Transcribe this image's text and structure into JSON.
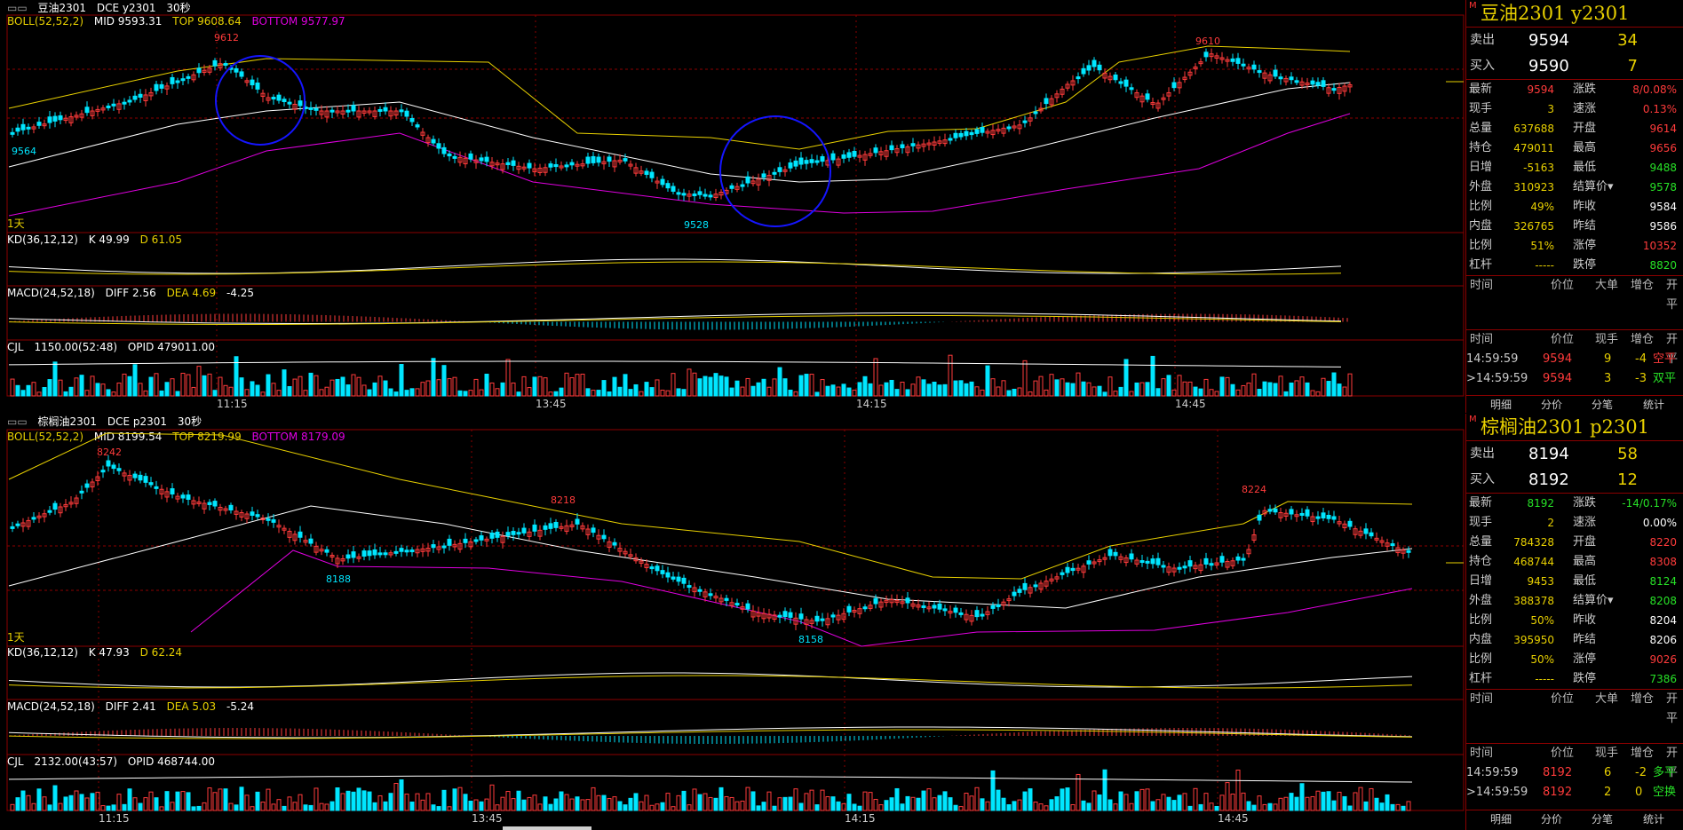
{
  "top": {
    "window_title": "豆油2301",
    "market": "DCE y2301",
    "interval": "30秒",
    "boll_label": "BOLL(52,52,2)",
    "boll_mid": "MID 9593.31",
    "boll_top": "TOP 9608.64",
    "boll_bottom": "BOTTOM 9577.97",
    "period_tag": "1天",
    "high_mark": "9612",
    "high_mark2": "9610",
    "low_mark": "9528",
    "left_mark": "9564",
    "kd_label": "KD(36,12,12)",
    "kd_k": "K 49.99",
    "kd_d": "D 61.05",
    "macd_label": "MACD(24,52,18)",
    "macd_diff": "DIFF 2.56",
    "macd_dea": "DEA 4.69",
    "macd_val": "-4.25",
    "cjl_label": "CJL",
    "cjl_val": "1150.00(52:48)",
    "cjl_opid": "OPID 479011.00",
    "times": [
      "11:15",
      "13:45",
      "14:15",
      "14:45"
    ],
    "side": {
      "title": "豆油2301  y2301",
      "sell_label": "卖出",
      "sell_price": "9594",
      "sell_vol": "34",
      "buy_label": "买入",
      "buy_price": "9590",
      "buy_vol": "7",
      "rows": [
        {
          "l1": "最新",
          "v1": "9594",
          "c1": "red",
          "l2": "涨跌",
          "v2": "8/0.08%",
          "c2": "red"
        },
        {
          "l1": "现手",
          "v1": "3",
          "c1": "yellow",
          "l2": "速涨",
          "v2": "0.13%",
          "c2": "red"
        },
        {
          "l1": "总量",
          "v1": "637688",
          "c1": "yellow",
          "l2": "开盘",
          "v2": "9614",
          "c2": "red"
        },
        {
          "l1": "持仓",
          "v1": "479011",
          "c1": "yellow",
          "l2": "最高",
          "v2": "9656",
          "c2": "red"
        },
        {
          "l1": "日增",
          "v1": "-5163",
          "c1": "yellow",
          "l2": "最低",
          "v2": "9488",
          "c2": "green"
        },
        {
          "l1": "外盘",
          "v1": "310923",
          "c1": "yellow",
          "l2": "结算价▾",
          "v2": "9578",
          "c2": "green"
        },
        {
          "l1": "比例",
          "v1": "49%",
          "c1": "yellow",
          "l2": "昨收",
          "v2": "9584",
          "c2": "white"
        },
        {
          "l1": "内盘",
          "v1": "326765",
          "c1": "yellow",
          "l2": "昨结",
          "v2": "9586",
          "c2": "white"
        },
        {
          "l1": "比例",
          "v1": "51%",
          "c1": "yellow",
          "l2": "涨停",
          "v2": "10352",
          "c2": "red"
        },
        {
          "l1": "杠杆",
          "v1": "-----",
          "c1": "yellow",
          "l2": "跌停",
          "v2": "8820",
          "c2": "green"
        }
      ],
      "big_hdr": [
        "时间",
        "价位",
        "大单",
        "增仓",
        "开平"
      ],
      "tick_hdr": [
        "时间",
        "价位",
        "现手",
        "增仓",
        "开平"
      ],
      "ticks": [
        {
          "time": "14:59:59",
          "price": "9594",
          "vol": "9",
          "chg": "-4",
          "type": "空平",
          "ctype": "red"
        },
        {
          "time": ">14:59:59",
          "price": "9594",
          "vol": "3",
          "chg": "-3",
          "type": "双平",
          "ctype": "green"
        }
      ]
    }
  },
  "bottom": {
    "window_title": "棕榈油2301",
    "market": "DCE p2301",
    "interval": "30秒",
    "boll_label": "BOLL(52,52,2)",
    "boll_mid": "MID 8199.54",
    "boll_top": "TOP 8219.99",
    "boll_bottom": "BOTTOM 8179.09",
    "period_tag": "1天",
    "high_mark": "8242",
    "mid_mark": "8218",
    "high_mark2": "8224",
    "low_mark": "8188",
    "low_mark2": "8158",
    "kd_label": "KD(36,12,12)",
    "kd_k": "K 47.93",
    "kd_d": "D 62.24",
    "macd_label": "MACD(24,52,18)",
    "macd_diff": "DIFF 2.41",
    "macd_dea": "DEA 5.03",
    "macd_val": "-5.24",
    "cjl_label": "CJL",
    "cjl_val": "2132.00(43:57)",
    "cjl_opid": "OPID 468744.00",
    "times": [
      "11:15",
      "13:45",
      "14:15",
      "14:45"
    ],
    "side": {
      "title": "棕榈油2301  p2301",
      "sell_label": "卖出",
      "sell_price": "8194",
      "sell_vol": "58",
      "buy_label": "买入",
      "buy_price": "8192",
      "buy_vol": "12",
      "rows": [
        {
          "l1": "最新",
          "v1": "8192",
          "c1": "green",
          "l2": "涨跌",
          "v2": "-14/0.17%",
          "c2": "green"
        },
        {
          "l1": "现手",
          "v1": "2",
          "c1": "yellow",
          "l2": "速涨",
          "v2": "0.00%",
          "c2": "white"
        },
        {
          "l1": "总量",
          "v1": "784328",
          "c1": "yellow",
          "l2": "开盘",
          "v2": "8220",
          "c2": "red"
        },
        {
          "l1": "持仓",
          "v1": "468744",
          "c1": "yellow",
          "l2": "最高",
          "v2": "8308",
          "c2": "red"
        },
        {
          "l1": "日增",
          "v1": "9453",
          "c1": "yellow",
          "l2": "最低",
          "v2": "8124",
          "c2": "green"
        },
        {
          "l1": "外盘",
          "v1": "388378",
          "c1": "yellow",
          "l2": "结算价▾",
          "v2": "8208",
          "c2": "green"
        },
        {
          "l1": "比例",
          "v1": "50%",
          "c1": "yellow",
          "l2": "昨收",
          "v2": "8204",
          "c2": "white"
        },
        {
          "l1": "内盘",
          "v1": "395950",
          "c1": "yellow",
          "l2": "昨结",
          "v2": "8206",
          "c2": "white"
        },
        {
          "l1": "比例",
          "v1": "50%",
          "c1": "yellow",
          "l2": "涨停",
          "v2": "9026",
          "c2": "red"
        },
        {
          "l1": "杠杆",
          "v1": "-----",
          "c1": "yellow",
          "l2": "跌停",
          "v2": "7386",
          "c2": "green"
        }
      ],
      "big_hdr": [
        "时间",
        "价位",
        "大单",
        "增仓",
        "开平"
      ],
      "tick_hdr": [
        "时间",
        "价位",
        "现手",
        "增仓",
        "开平"
      ],
      "ticks": [
        {
          "time": "14:59:59",
          "price": "8192",
          "vol": "6",
          "chg": "-2",
          "type": "多平",
          "ctype": "green"
        },
        {
          "time": ">14:59:59",
          "price": "8192",
          "vol": "2",
          "chg": "0",
          "type": "空换",
          "ctype": "green"
        }
      ]
    }
  },
  "tabs": [
    "明细",
    "分价",
    "分笔",
    "统计"
  ],
  "colors": {
    "up": "#ff3b3b",
    "down": "#00e6ff",
    "mid": "#ffffff",
    "top": "#e8d000",
    "bottom": "#e000e0",
    "grid": "#8b0000"
  }
}
